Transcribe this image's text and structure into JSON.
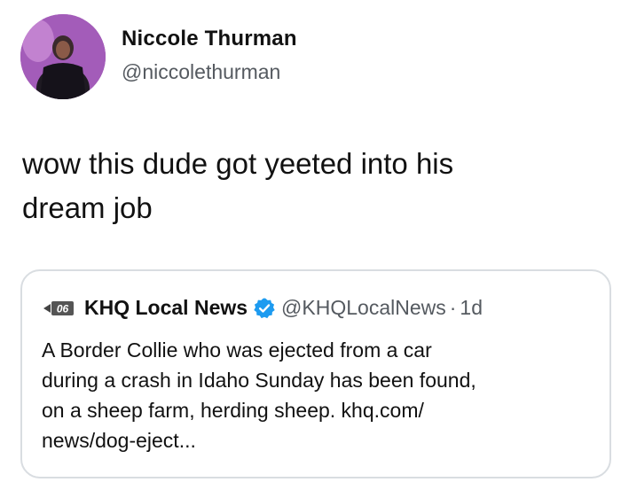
{
  "tweet": {
    "author_name": "Niccole Thurman",
    "author_handle": "@niccolethurman",
    "text_line1": "wow this dude got yeeted into his",
    "text_line2": "dream job"
  },
  "quoted_tweet": {
    "author_name": "KHQ Local News",
    "author_handle": "@KHQLocalNews",
    "separator": "·",
    "time": "1d",
    "text_line1": "A Border Collie who was ejected from a car",
    "text_line2": "during a crash in Idaho Sunday has been found,",
    "text_line3": "on a sheep farm, herding sheep. khq.com/",
    "text_line4": "news/dog-eject...",
    "logo_text": "06"
  },
  "colors": {
    "verified_badge": "#1d9bf0",
    "avatar_bg": "#9b4fb0",
    "border": "#d9dde1",
    "secondary_text": "#555a60"
  },
  "icons": {
    "avatar": "profile-photo",
    "verified": "verified-badge-icon",
    "logo": "khq-logo-icon"
  }
}
